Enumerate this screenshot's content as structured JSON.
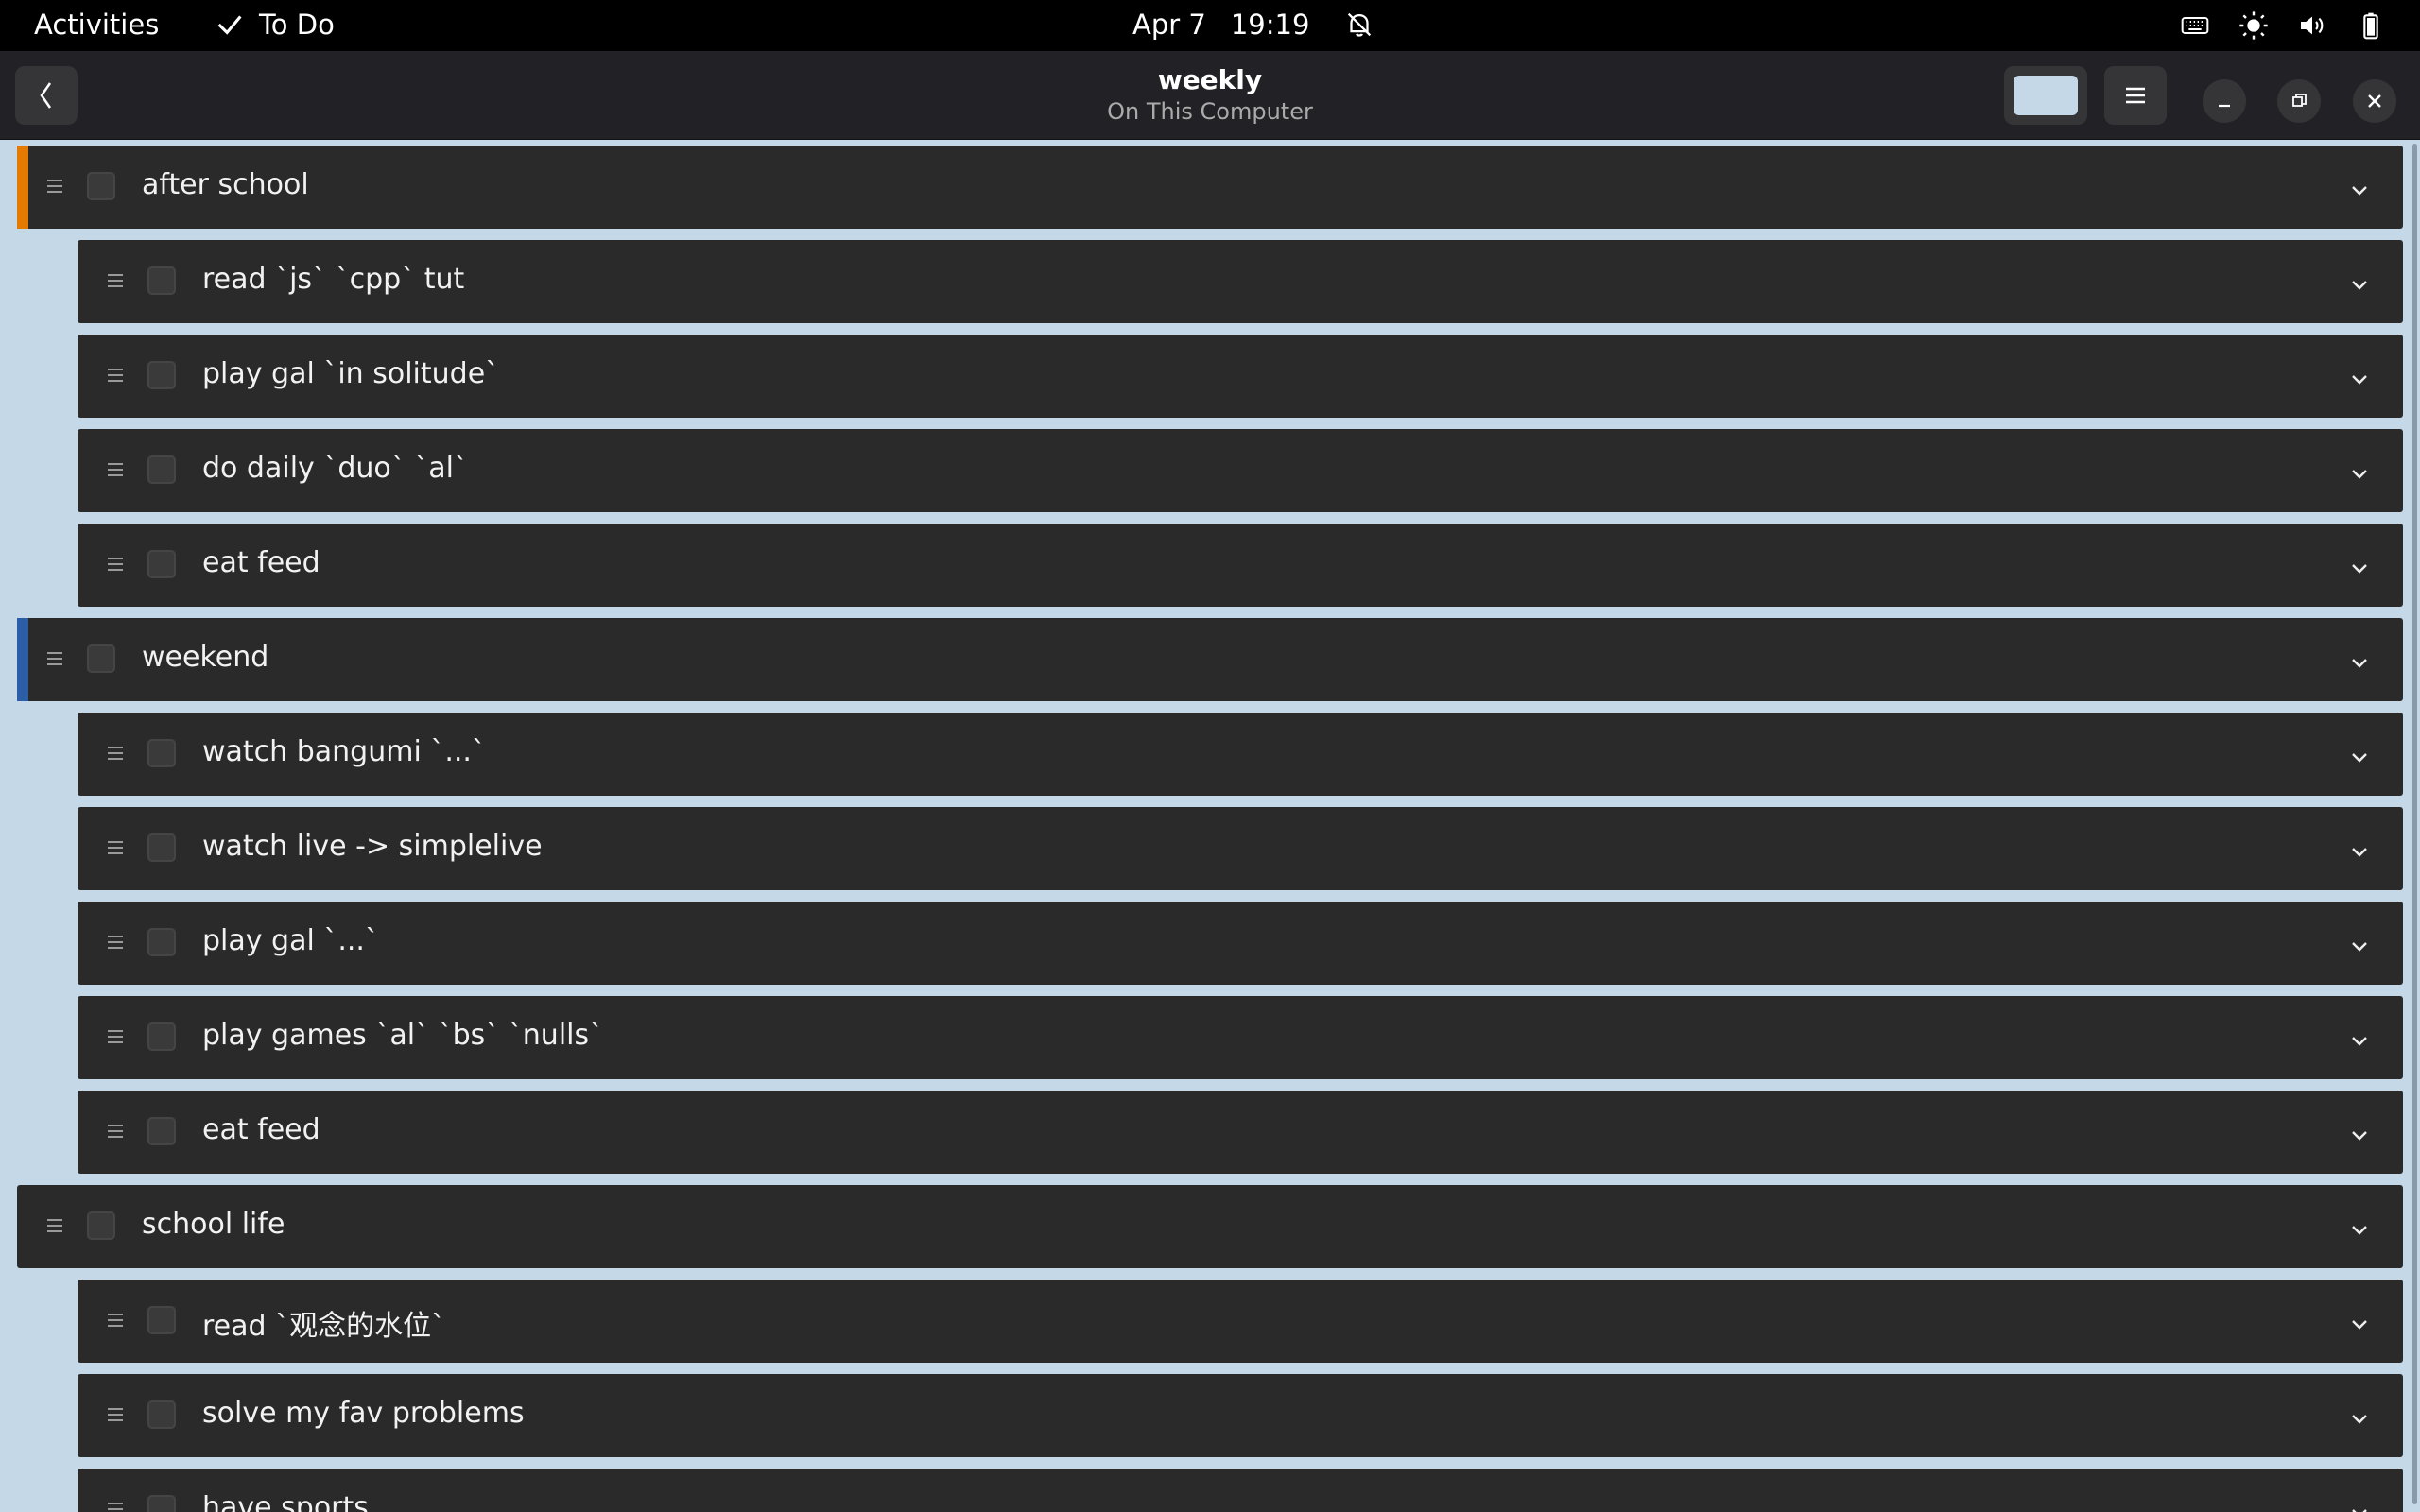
{
  "topbar": {
    "activities": "Activities",
    "app_name": "To Do",
    "date": "Apr 7",
    "time": "19:19"
  },
  "headerbar": {
    "title": "weekly",
    "subtitle": "On This Computer"
  },
  "colors": {
    "accent_orange": "#e57a00",
    "accent_blue": "#2c5ea8",
    "list_color": "#c4d8e8"
  },
  "tasks": [
    {
      "label": "after school",
      "level": 0,
      "accent": "#e57a00"
    },
    {
      "label": "read `js` `cpp` tut",
      "level": 1
    },
    {
      "label": "play gal `in solitude`",
      "level": 1
    },
    {
      "label": "do daily `duo` `al`",
      "level": 1
    },
    {
      "label": "eat feed",
      "level": 1
    },
    {
      "label": "weekend",
      "level": 0,
      "accent": "#2c5ea8"
    },
    {
      "label": "watch bangumi `...`",
      "level": 1
    },
    {
      "label": "watch live -> simplelive",
      "level": 1
    },
    {
      "label": "play gal `...`",
      "level": 1
    },
    {
      "label": "play games `al` `bs` `nulls`",
      "level": 1
    },
    {
      "label": "eat feed",
      "level": 1
    },
    {
      "label": "school life",
      "level": 0
    },
    {
      "label": "read `观念的水位`",
      "level": 1
    },
    {
      "label": "solve my fav problems",
      "level": 1
    },
    {
      "label": "have sports",
      "level": 1
    }
  ]
}
